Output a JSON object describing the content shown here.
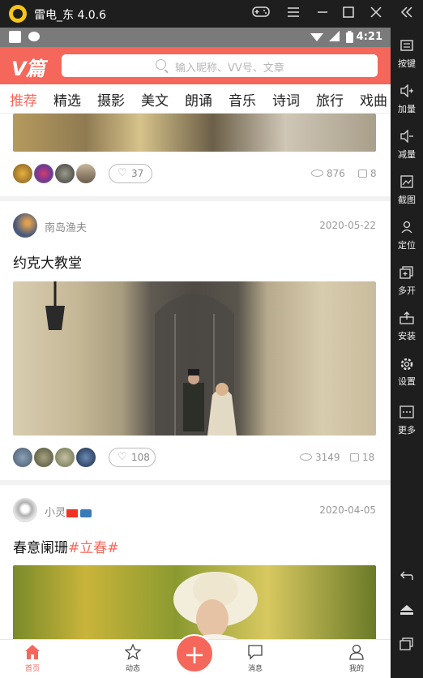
{
  "window": {
    "title": "雷电_东 4.0.6",
    "buttons": [
      "gamepad-icon",
      "menu-icon",
      "minimize-icon",
      "maximize-icon",
      "close-icon",
      "collapse-icon"
    ]
  },
  "sidebar": {
    "items": [
      {
        "label": "按键",
        "icon": "keyboard-icon"
      },
      {
        "label": "加量",
        "icon": "volume-up-icon"
      },
      {
        "label": "减量",
        "icon": "volume-down-icon"
      },
      {
        "label": "截图",
        "icon": "screenshot-icon"
      },
      {
        "label": "定位",
        "icon": "location-icon"
      },
      {
        "label": "多开",
        "icon": "multi-instance-icon"
      },
      {
        "label": "安装",
        "icon": "install-icon"
      },
      {
        "label": "设置",
        "icon": "gear-icon"
      },
      {
        "label": "更多",
        "icon": "more-icon"
      }
    ],
    "nav": [
      "back-icon",
      "home-icon",
      "recents-icon"
    ]
  },
  "statusbar": {
    "time": "4:21"
  },
  "app": {
    "brand": "V篇",
    "search_placeholder": "输入昵称、VV号、文章"
  },
  "tabs": [
    "推荐",
    "精选",
    "摄影",
    "美文",
    "朗诵",
    "音乐",
    "诗词",
    "旅行",
    "戏曲"
  ],
  "active_tab": "推荐",
  "posts": [
    {
      "likes": "37",
      "views": "876",
      "comments": "8"
    },
    {
      "author": "南岛渔夫",
      "date": "2020-05-22",
      "title": "约克大教堂",
      "likes": "108",
      "views": "3149",
      "comments": "18"
    },
    {
      "author": "小灵",
      "date": "2020-04-05",
      "title": "春意阑珊",
      "tag": "#立春#"
    }
  ],
  "bottom_nav": {
    "home": "首页",
    "dynamic": "动态",
    "messages": "消息",
    "mine": "我的"
  },
  "colors": {
    "accent": "#f4675a",
    "emulator_chrome": "#1e1e1e"
  }
}
